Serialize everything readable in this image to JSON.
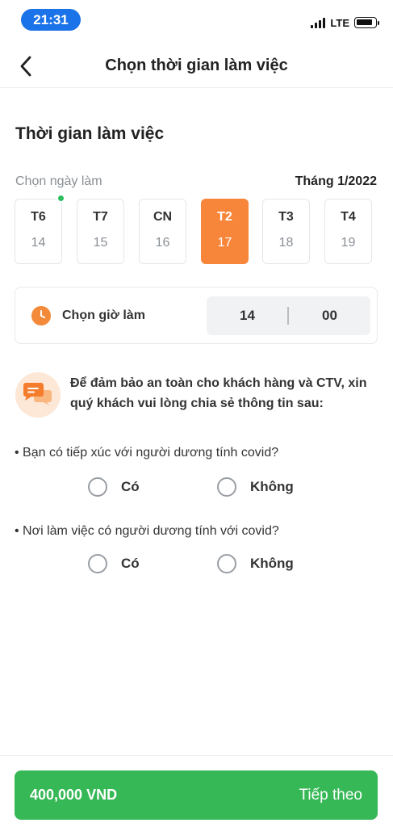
{
  "status_bar": {
    "time": "21:31",
    "network": "LTE",
    "icons": [
      "signal-icon",
      "battery-icon"
    ]
  },
  "header": {
    "title": "Chọn thời gian làm việc",
    "back_icon": "chevron-left-icon"
  },
  "work_time": {
    "section_title": "Thời gian làm việc",
    "pick_day_label": "Chọn ngày làm",
    "month_label": "Tháng 1/2022",
    "days": [
      {
        "name": "T6",
        "date": "14"
      },
      {
        "name": "T7",
        "date": "15"
      },
      {
        "name": "CN",
        "date": "16"
      },
      {
        "name": "T2",
        "date": "17"
      },
      {
        "name": "T3",
        "date": "18"
      },
      {
        "name": "T4",
        "date": "19"
      }
    ],
    "selected_day": "T2",
    "pick_time_label": "Chọn giờ làm",
    "hour": "14",
    "minute": "00"
  },
  "covid": {
    "notice": "Để đảm bảo an toàn cho khách hàng và CTV, xin quý khách vui lòng chia sẻ thông tin sau:",
    "questions": [
      {
        "text": "• Bạn có tiếp xúc với người dương tính covid?",
        "options": [
          "Có",
          "Không"
        ]
      },
      {
        "text": "• Nơi làm việc có người dương tính với covid?",
        "options": [
          "Có",
          "Không"
        ]
      }
    ]
  },
  "footer": {
    "price": "400,000 VND",
    "next_label": "Tiếp theo"
  },
  "colors": {
    "primary_green": "#36b856",
    "accent_orange": "#f7863a",
    "today_dot": "#2dbe60",
    "status_pill": "#1a73e8"
  }
}
